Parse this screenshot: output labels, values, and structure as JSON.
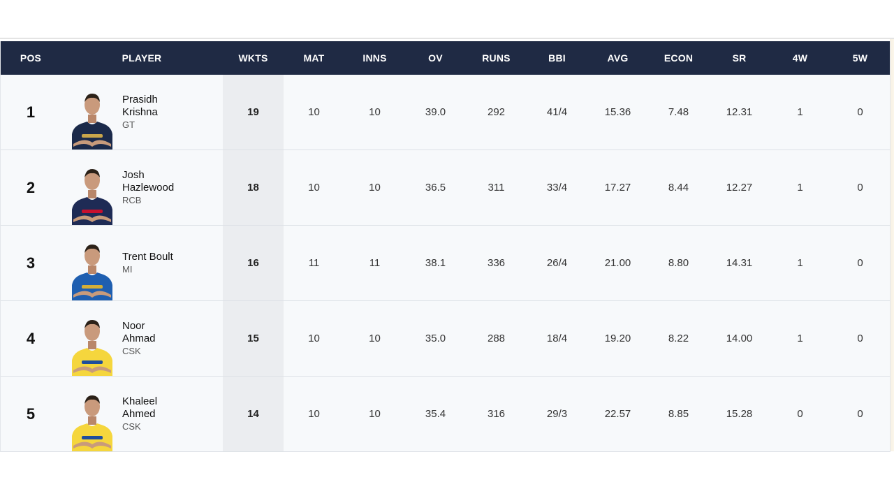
{
  "columns": [
    "POS",
    "PLAYER",
    "WKTS",
    "MAT",
    "INNS",
    "OV",
    "RUNS",
    "BBI",
    "AVG",
    "ECON",
    "SR",
    "4W",
    "5W"
  ],
  "rows": [
    {
      "pos": "1",
      "name_line1": "Prasidh",
      "name_line2": "Krishna",
      "team": "GT",
      "wkts": "19",
      "mat": "10",
      "inns": "10",
      "ov": "39.0",
      "runs": "292",
      "bbi": "41/4",
      "avg": "15.36",
      "econ": "7.48",
      "sr": "12.31",
      "w4": "1",
      "w5": "0",
      "jersey_color": "#1b2a4a",
      "accent_color": "#c9a64b",
      "avatar_icon": "player-avatar-icon"
    },
    {
      "pos": "2",
      "name_line1": "Josh",
      "name_line2": "Hazlewood",
      "team": "RCB",
      "wkts": "18",
      "mat": "10",
      "inns": "10",
      "ov": "36.5",
      "runs": "311",
      "bbi": "33/4",
      "avg": "17.27",
      "econ": "8.44",
      "sr": "12.27",
      "w4": "1",
      "w5": "0",
      "jersey_color": "#1e2b55",
      "accent_color": "#c8102e",
      "avatar_icon": "player-avatar-icon"
    },
    {
      "pos": "3",
      "name_line1": "Trent Boult",
      "name_line2": "",
      "team": "MI",
      "wkts": "16",
      "mat": "11",
      "inns": "11",
      "ov": "38.1",
      "runs": "336",
      "bbi": "26/4",
      "avg": "21.00",
      "econ": "8.80",
      "sr": "14.31",
      "w4": "1",
      "w5": "0",
      "jersey_color": "#1f5fb0",
      "accent_color": "#d4af37",
      "avatar_icon": "player-avatar-icon"
    },
    {
      "pos": "4",
      "name_line1": "Noor",
      "name_line2": "Ahmad",
      "team": "CSK",
      "wkts": "15",
      "mat": "10",
      "inns": "10",
      "ov": "35.0",
      "runs": "288",
      "bbi": "18/4",
      "avg": "19.20",
      "econ": "8.22",
      "sr": "14.00",
      "w4": "1",
      "w5": "0",
      "jersey_color": "#f5d63d",
      "accent_color": "#1f4e9c",
      "avatar_icon": "player-avatar-icon"
    },
    {
      "pos": "5",
      "name_line1": "Khaleel",
      "name_line2": "Ahmed",
      "team": "CSK",
      "wkts": "14",
      "mat": "10",
      "inns": "10",
      "ov": "35.4",
      "runs": "316",
      "bbi": "29/3",
      "avg": "22.57",
      "econ": "8.85",
      "sr": "15.28",
      "w4": "0",
      "w5": "0",
      "jersey_color": "#f5d63d",
      "accent_color": "#1f4e9c",
      "avatar_icon": "player-avatar-icon"
    }
  ],
  "colors": {
    "header_bg": "#1f2a44",
    "header_text": "#ffffff",
    "row_bg": "#f7f9fb",
    "wkts_col_bg": "#ebedf0"
  }
}
